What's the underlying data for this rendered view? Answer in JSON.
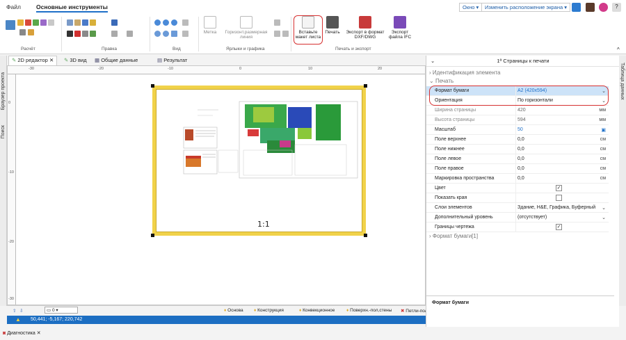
{
  "menu": {
    "file": "Файл",
    "main_tools": "Основные инструменты"
  },
  "top_right": {
    "window": "Окно",
    "layout": "Изменить расположение экрана"
  },
  "ribbon": {
    "group_calc": "Расчёт",
    "group_edit": "Правка",
    "group_view": "Вид",
    "group_labels": "Ярлыки и графика",
    "group_print": "Печать и экспорт",
    "metka": "Метка",
    "dim_line": "Горизонт.размерная линия",
    "insert_sheet": "Вставьте макет листа",
    "print": "Печать",
    "export_dxf": "Экспорт в формат DXF/DWG",
    "export_ifc": "Экспорт файла IFC"
  },
  "tabs": [
    {
      "label": "2D редактор"
    },
    {
      "label": "3D вид"
    },
    {
      "label": "Общие данные"
    },
    {
      "label": "Результат"
    }
  ],
  "left_dock": {
    "browser": "Браузер проекта",
    "search": "Поиск"
  },
  "right_dock": {
    "table": "Таблица данных"
  },
  "ruler": {
    "top_ticks": [
      "-30",
      "-20",
      "-10",
      "0",
      "10",
      "20"
    ],
    "left_ticks": [
      "0",
      "-10",
      "-20",
      "-30"
    ]
  },
  "canvas": {
    "scale_label": "1:1"
  },
  "layers": {
    "floor_value": "0",
    "items": [
      "Основа",
      "Конструкция",
      "Конвекционное",
      "Поверхн.-пол,стены",
      "Петли-пол"
    ]
  },
  "status": {
    "coords": "50,441; -5,167; 220,742"
  },
  "bottom": {
    "diagnostics": "Диагностика"
  },
  "panel": {
    "title": "1ª Страницы к печати",
    "section_ident": "Идентификация элемента",
    "section_print": "Печать",
    "section_paper": "Формат бумаги[1]",
    "rows": [
      {
        "label": "Формат бумаги",
        "value": "A2 (420x594)",
        "unit": ""
      },
      {
        "label": "Ориентация",
        "value": "По горизонтали",
        "unit": ""
      },
      {
        "label": "Ширина страницы",
        "value": "420",
        "unit": "мм"
      },
      {
        "label": "Высота страницы",
        "value": "594",
        "unit": "мм"
      },
      {
        "label": "Масштаб",
        "value": "50",
        "unit": ""
      },
      {
        "label": "Поле верхнее",
        "value": "0,0",
        "unit": "см"
      },
      {
        "label": "Поле нижнее",
        "value": "0,0",
        "unit": "см"
      },
      {
        "label": "Поле левое",
        "value": "0,0",
        "unit": "см"
      },
      {
        "label": "Поле правое",
        "value": "0,0",
        "unit": "см"
      },
      {
        "label": "Маркировка пространства",
        "value": "0,0",
        "unit": "см"
      },
      {
        "label": "Цвет",
        "value": "",
        "unit": ""
      },
      {
        "label": "Показать края",
        "value": "",
        "unit": ""
      },
      {
        "label": "Слои элементов",
        "value": "Здание, H&E, Графика, Буферный",
        "unit": ""
      },
      {
        "label": "Дополнительный уровень",
        "value": "(отсутствует)",
        "unit": ""
      },
      {
        "label": "Границы чертежа",
        "value": "",
        "unit": ""
      }
    ],
    "checks": {
      "color": true,
      "show_edges": false,
      "borders": true
    },
    "description_title": "Формат бумаги"
  },
  "colors": {
    "accent": "#1e6fc8",
    "status_bar": "#1c6ec2",
    "highlight": "#d63030",
    "sheet_border": "#f1d24a",
    "selected_row": "#cde3f8"
  }
}
